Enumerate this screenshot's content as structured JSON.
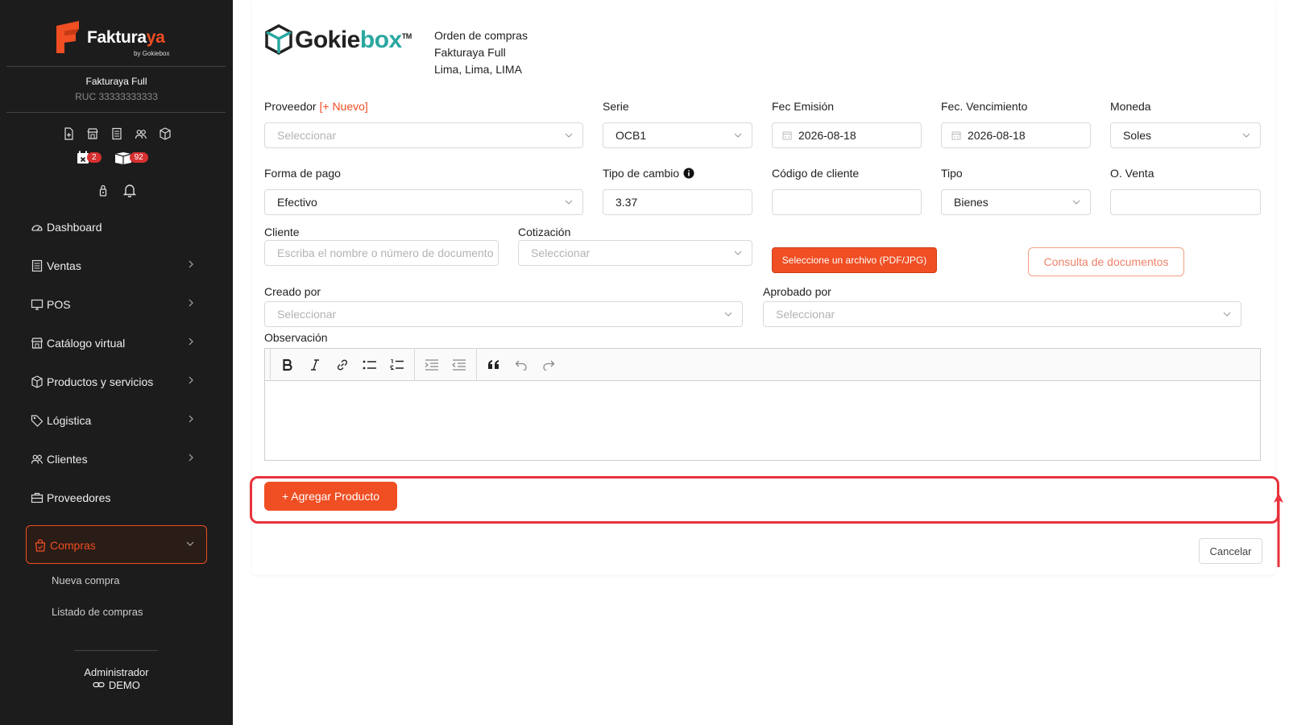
{
  "sidebar": {
    "brand": {
      "main": "Faktura",
      "accent": "ya",
      "sub": "by Gokiebox"
    },
    "company_name": "Fakturaya Full",
    "company_ruc": "RUC 33333333333",
    "badges": {
      "calendar": "2",
      "boxes": "92"
    },
    "nav": [
      {
        "label": "Dashboard"
      },
      {
        "label": "Ventas"
      },
      {
        "label": "POS"
      },
      {
        "label": "Catálogo virtual"
      },
      {
        "label": "Productos y servicios"
      },
      {
        "label": "Lógistica"
      },
      {
        "label": "Clientes"
      },
      {
        "label": "Proveedores"
      },
      {
        "label": "Compras"
      }
    ],
    "sub_items": [
      {
        "label": "Nueva compra"
      },
      {
        "label": "Listado de compras"
      }
    ],
    "footer_role": "Administrador",
    "footer_user": "DEMO"
  },
  "header": {
    "logo_main": "Gokie",
    "logo_accent": "box",
    "logo_tm": "TM",
    "line1": "Orden de compras",
    "line2": "Fakturaya Full",
    "line3": "Lima, Lima, LIMA"
  },
  "form": {
    "proveedor_label": "Proveedor",
    "proveedor_new": "[+ Nuevo]",
    "proveedor_placeholder": "Seleccionar",
    "serie_label": "Serie",
    "serie_value": "OCB1",
    "fec_emision_label": "Fec Emisión",
    "fec_emision_value": "2026-08-18",
    "fec_venc_label": "Fec. Vencimiento",
    "fec_venc_value": "2026-08-18",
    "moneda_label": "Moneda",
    "moneda_value": "Soles",
    "forma_pago_label": "Forma de pago",
    "forma_pago_value": "Efectivo",
    "tipo_cambio_label": "Tipo de cambio",
    "tipo_cambio_value": "3.37",
    "codigo_cliente_label": "Código de cliente",
    "codigo_cliente_value": "",
    "tipo_label": "Tipo",
    "tipo_value": "Bienes",
    "o_venta_label": "O. Venta",
    "o_venta_value": "",
    "cliente_label": "Cliente",
    "cliente_placeholder": "Escriba el nombre o número de documento",
    "cotizacion_label": "Cotización",
    "cotizacion_placeholder": "Seleccionar",
    "file_button": "Seleccione un archivo (PDF/JPG)",
    "consulta_button": "Consulta de documentos",
    "creado_por_label": "Creado por",
    "creado_por_placeholder": "Seleccionar",
    "aprobado_por_label": "Aprobado por",
    "aprobado_por_placeholder": "Seleccionar",
    "observacion_label": "Observación"
  },
  "actions": {
    "add_product": "+ Agregar Producto",
    "cancel": "Cancelar"
  },
  "colors": {
    "accent": "#f04e23",
    "sidebar_bg": "#1c1c1c",
    "highlight": "#e8323c",
    "logo_teal": "#2aa7a0"
  }
}
